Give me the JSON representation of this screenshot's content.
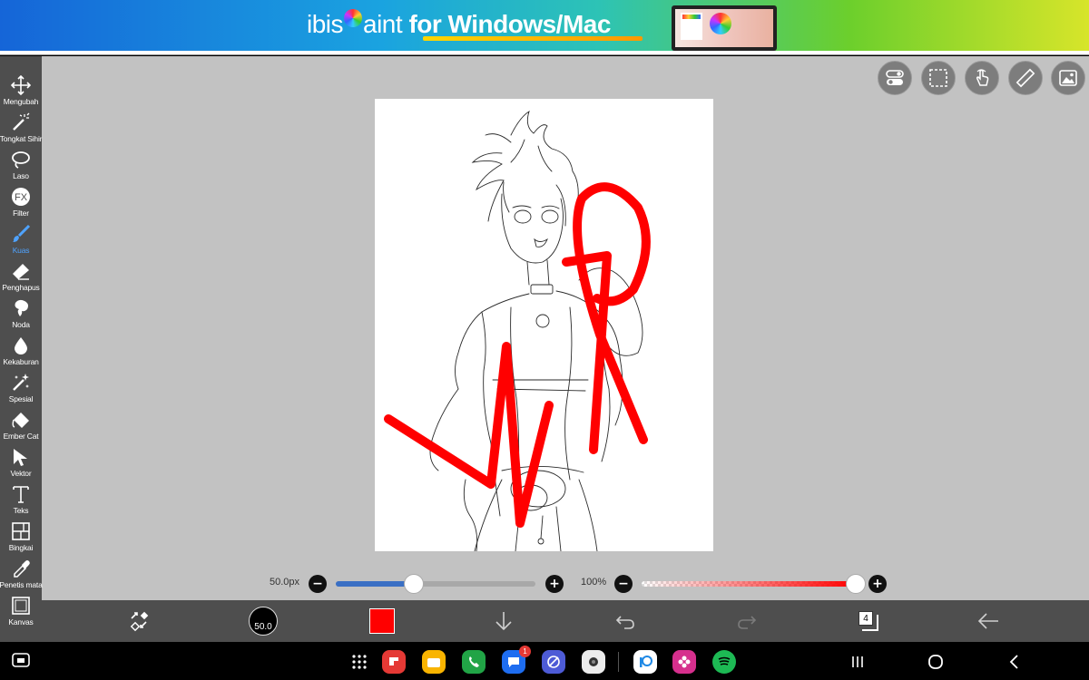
{
  "banner": {
    "logo_pre": "ibis",
    "logo_post": "aint",
    "tagline": " for Windows/Mac"
  },
  "tools": [
    {
      "id": "move",
      "label": "Mengubah",
      "icon": "move-icon"
    },
    {
      "id": "magic-wand",
      "label": "Tongkat Sihir",
      "icon": "magic-wand-icon"
    },
    {
      "id": "lasso",
      "label": "Laso",
      "icon": "lasso-icon"
    },
    {
      "id": "filter",
      "label": "Filter",
      "icon": "fx-icon"
    },
    {
      "id": "brush",
      "label": "Kuas",
      "icon": "brush-icon",
      "active": true
    },
    {
      "id": "eraser",
      "label": "Penghapus",
      "icon": "eraser-icon"
    },
    {
      "id": "smudge",
      "label": "Noda",
      "icon": "smudge-icon"
    },
    {
      "id": "blur",
      "label": "Kekaburan",
      "icon": "blur-drop-icon"
    },
    {
      "id": "special",
      "label": "Spesial",
      "icon": "special-wand-icon"
    },
    {
      "id": "bucket",
      "label": "Ember Cat",
      "icon": "paint-bucket-icon"
    },
    {
      "id": "vector",
      "label": "Vektor",
      "icon": "vector-arrow-icon"
    },
    {
      "id": "text",
      "label": "Teks",
      "icon": "text-icon"
    },
    {
      "id": "frame",
      "label": "Bingkai",
      "icon": "frame-icon"
    },
    {
      "id": "eyedropper",
      "label": "Penetis mata",
      "icon": "eyedropper-icon"
    },
    {
      "id": "canvas",
      "label": "Kanvas",
      "icon": "canvas-icon"
    }
  ],
  "brush_size": {
    "label": "50.0px",
    "fraction": 0.39
  },
  "opacity": {
    "label": "100%",
    "fraction": 1.0
  },
  "bottom": {
    "brush_preview_value": "50.0",
    "color": "#ff0000",
    "layer_count": "4"
  },
  "canvas": {
    "stroke_color": "#ff0000",
    "background": "#ffffff"
  },
  "nav_apps": [
    {
      "name": "app-grid-icon"
    },
    {
      "name": "flipboard-app-icon",
      "color": "#e53935"
    },
    {
      "name": "my-files-app-icon",
      "color": "#f9b400"
    },
    {
      "name": "phone-app-icon",
      "color": "#21a446"
    },
    {
      "name": "messages-app-icon",
      "color": "#1e6df0",
      "badge": "1"
    },
    {
      "name": "internet-app-icon",
      "color": "#4d5bd6"
    },
    {
      "name": "camera-app-icon",
      "color": "#ececec"
    },
    {
      "name": "ibispaint-app-icon",
      "color": "#ffffff"
    },
    {
      "name": "gallery-app-icon",
      "color": "#d62f8d"
    },
    {
      "name": "spotify-app-icon",
      "color": "#1db954"
    }
  ]
}
